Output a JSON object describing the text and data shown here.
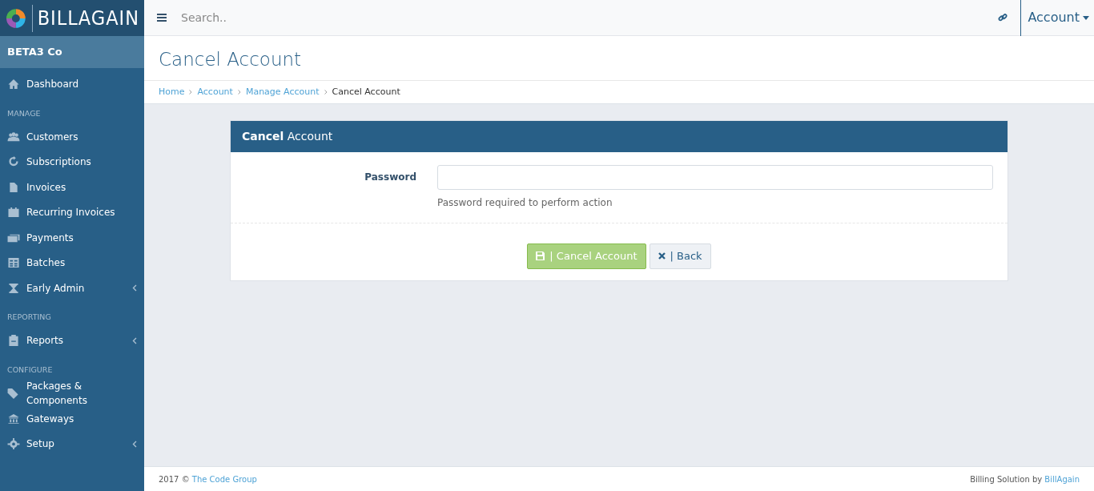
{
  "brand": {
    "logo_text": "**BILL**AGAIN"
  },
  "topbar": {
    "search": {
      "placeholder": "Search.."
    },
    "account_menu": "Account"
  },
  "sidebar": {
    "company": "BETA3 Co",
    "items": [
      {
        "kind": "item",
        "label": "Dashboard",
        "has_submenu": false
      },
      {
        "kind": "header",
        "label": "MANAGE"
      },
      {
        "kind": "item",
        "label": "Customers",
        "has_submenu": false
      },
      {
        "kind": "item",
        "label": "Subscriptions",
        "has_submenu": false
      },
      {
        "kind": "item",
        "label": "Invoices",
        "has_submenu": false
      },
      {
        "kind": "item",
        "label": "Recurring Invoices",
        "has_submenu": false
      },
      {
        "kind": "item",
        "label": "Payments",
        "has_submenu": false
      },
      {
        "kind": "item",
        "label": "Batches",
        "has_submenu": false
      },
      {
        "kind": "item",
        "label": "Early Admin",
        "has_submenu": true
      },
      {
        "kind": "header",
        "label": "REPORTING"
      },
      {
        "kind": "item",
        "label": "Reports",
        "has_submenu": true
      },
      {
        "kind": "header",
        "label": "CONFIGURE"
      },
      {
        "kind": "item",
        "label": "Packages & Components",
        "has_submenu": false
      },
      {
        "kind": "item",
        "label": "Gateways",
        "has_submenu": false
      },
      {
        "kind": "item",
        "label": "Setup",
        "has_submenu": true
      }
    ]
  },
  "page": {
    "title": "Cancel Account",
    "breadcrumb": [
      {
        "label": "Home",
        "current": false
      },
      {
        "label": "Account",
        "current": false
      },
      {
        "label": "Manage Account",
        "current": false
      },
      {
        "label": "Cancel Account",
        "current": true
      }
    ]
  },
  "card": {
    "title": "**Cancel** Account",
    "field": {
      "label": "Password",
      "help": "Password required to perform action"
    },
    "buttons": [
      {
        "kind": "primary",
        "label": "| Cancel Account"
      },
      {
        "kind": "secondary",
        "label": "| Back"
      }
    ]
  },
  "footer": {
    "left_text": "2017 ©",
    "left_link": "The Code Group",
    "right_text": "Billing Solution by",
    "right_link": "BillAgain"
  }
}
